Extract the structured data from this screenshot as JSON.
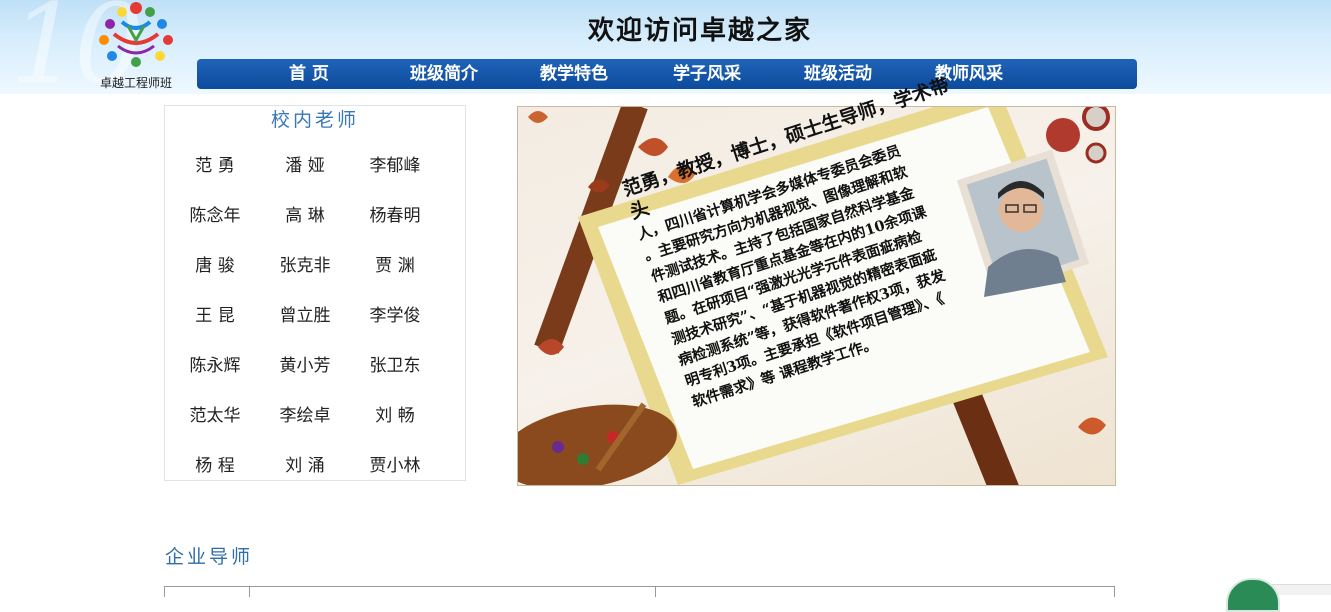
{
  "header": {
    "site_title": "欢迎访问卓越之家",
    "logo_text": "卓越工程师班",
    "deco_text": "10"
  },
  "nav": {
    "items": [
      "首 页",
      "班级简介",
      "教学特色",
      "学子风采",
      "班级活动",
      "教师风采"
    ]
  },
  "teachers": {
    "title": "校内老师",
    "names": [
      "范 勇",
      "潘 娅",
      "李郁峰",
      "陈念年",
      "高 琳",
      "杨春明",
      "唐 骏",
      "张克非",
      "贾 渊",
      "王 昆",
      "曾立胜",
      "李学俊",
      "陈永辉",
      "黄小芳",
      "张卫东",
      "范太华",
      "李绘卓",
      "刘 畅",
      "杨 程",
      "刘 涌",
      "贾小林"
    ]
  },
  "feature": {
    "lines": [
      "范勇，教授，博士，硕士生导师，学术带头",
      "人，四川省计算机学会多媒体专委员会委员",
      "。主要研究方向为机器视觉、图像理解和软",
      "件测试技术。主持了包括国家自然科学基金",
      "和四川省教育厅重点基金等在内的10余项课",
      "题。在研项目“强激光光学元件表面疵病检",
      "测技术研究”、“基于机器视觉的精密表面疵",
      "病检测系统”等，获得软件著作权3项，获发",
      "明专利3项。主要承担《软件项目管理》、《",
      "软件需求》等 课程教学工作。"
    ]
  },
  "section": {
    "enterprise_title": "企业导师"
  },
  "colors": {
    "nav_bg": "#0d4b9c",
    "header_bg": "#cfe8fa",
    "title_blue": "#3a77b8"
  }
}
